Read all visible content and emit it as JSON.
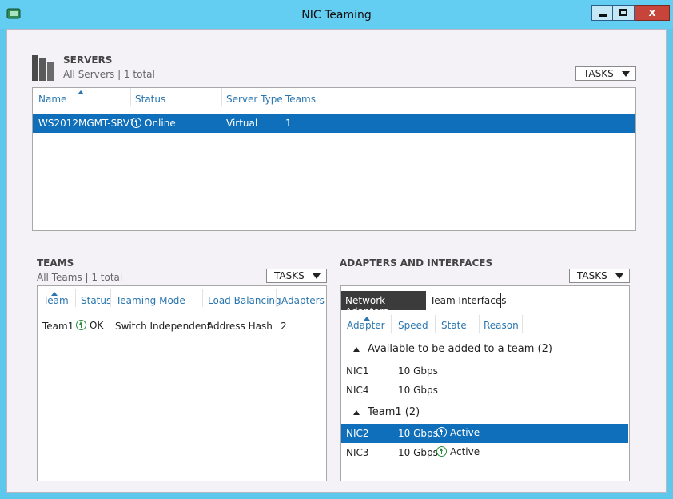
{
  "window": {
    "title": "NIC Teaming"
  },
  "controls": {
    "close": "x"
  },
  "servers": {
    "title": "SERVERS",
    "subtitle": "All Servers | 1 total",
    "tasks": "TASKS",
    "columns": [
      "Name",
      "Status",
      "Server Type",
      "Teams"
    ],
    "rows": [
      {
        "name": "WS2012MGMT-SRV1",
        "status": "Online",
        "type": "Virtual",
        "teams": "1"
      }
    ]
  },
  "teams": {
    "title": "TEAMS",
    "subtitle": "All Teams | 1 total",
    "tasks": "TASKS",
    "columns": [
      "Team",
      "Status",
      "Teaming Mode",
      "Load Balancing",
      "Adapters"
    ],
    "rows": [
      {
        "team": "Team1",
        "status": "OK",
        "mode": "Switch Independent",
        "lb": "Address Hash",
        "adapters": "2"
      }
    ]
  },
  "adapters": {
    "title": "ADAPTERS AND INTERFACES",
    "tasks": "TASKS",
    "tabs": [
      "Network Adapters",
      "Team Interfaces"
    ],
    "columns": [
      "Adapter",
      "Speed",
      "State",
      "Reason"
    ],
    "groups": [
      {
        "label": "Available to be added to a team (2)",
        "rows": [
          {
            "adapter": "NIC1",
            "speed": "10 Gbps",
            "state": ""
          },
          {
            "adapter": "NIC4",
            "speed": "10 Gbps",
            "state": ""
          }
        ]
      },
      {
        "label": "Team1 (2)",
        "rows": [
          {
            "adapter": "NIC2",
            "speed": "10 Gbps",
            "state": "Active"
          },
          {
            "adapter": "NIC3",
            "speed": "10 Gbps",
            "state": "Active"
          }
        ]
      }
    ]
  },
  "colors": {
    "selection": "#0f6fba",
    "header_link": "#2a76b0",
    "titlebar": "#63cdf2"
  }
}
